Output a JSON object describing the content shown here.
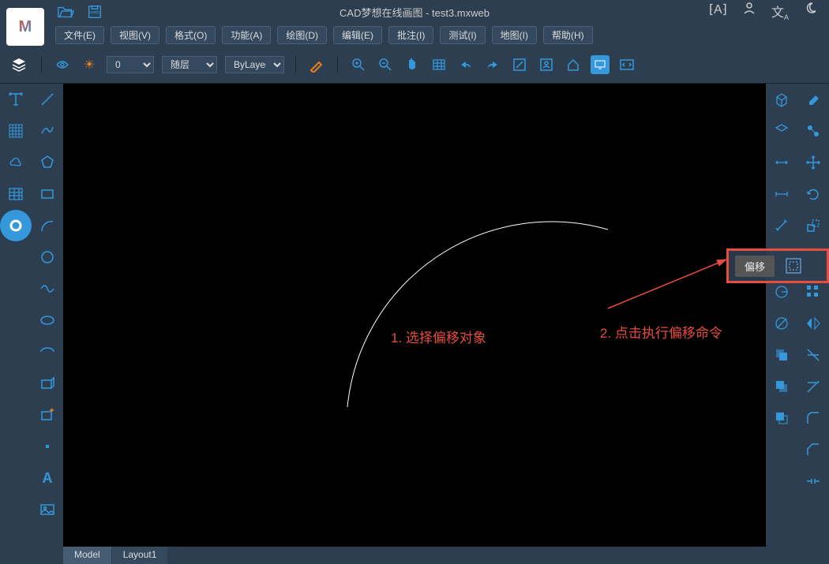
{
  "app": {
    "title": "CAD梦想在线画图 - test3.mxweb",
    "logo": "M"
  },
  "menu": {
    "file": "文件(E)",
    "view": "视图(V)",
    "format": "格式(O)",
    "function": "功能(A)",
    "draw": "绘图(D)",
    "edit": "编辑(E)",
    "annotate": "批注(I)",
    "test": "测试(I)",
    "map": "地图(I)",
    "help": "帮助(H)"
  },
  "toolbar": {
    "layer_combo": "0",
    "linetype": "随层",
    "color": "ByLayer"
  },
  "tooltip": {
    "offset": "偏移"
  },
  "annotations": {
    "step1": "1. 选择偏移对象",
    "step2": "2. 点击执行偏移命令"
  },
  "tabs": {
    "model": "Model",
    "layout1": "Layout1"
  },
  "icons": {
    "open": "open-folder-icon",
    "save": "save-web-icon",
    "ai": "ai-icon",
    "user": "user-icon",
    "lang": "language-icon",
    "theme": "theme-icon"
  }
}
